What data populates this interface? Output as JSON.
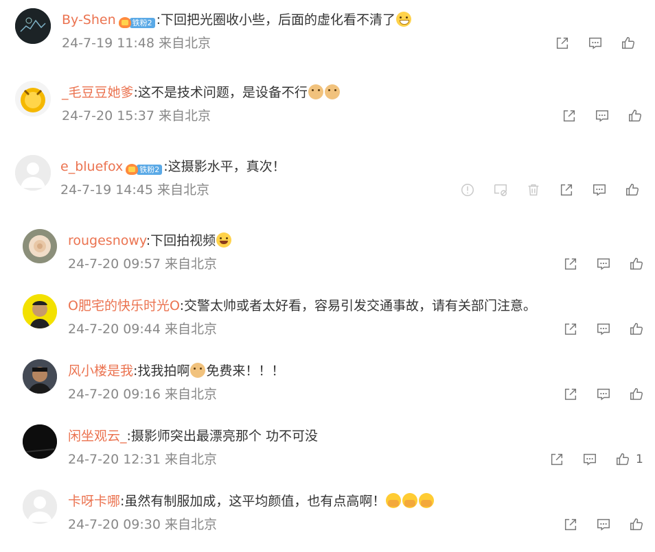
{
  "colors": {
    "username": "#eb7350",
    "meta": "#888888",
    "icon": "#777777",
    "icon_light": "#c8c8c8"
  },
  "comments": [
    {
      "username": "By-Shen",
      "fan_badge": "铁粉2",
      "text": ":下回把光圈收小些，后面的虚化看不清了",
      "emojis": [
        "grin"
      ],
      "time": "24-7-19 11:48",
      "location": "来自北京",
      "likes": ""
    },
    {
      "username": "_毛豆豆她爹",
      "fan_badge": "",
      "text": ":这不是技术问题，是设备不行",
      "emojis": [
        "doge",
        "doge"
      ],
      "time": "24-7-20 15:37",
      "location": "来自北京",
      "likes": ""
    },
    {
      "username": "e_bluefox",
      "fan_badge": "铁粉2",
      "text": ":这摄影水平，真次！",
      "emojis": [],
      "time": "24-7-19 14:45",
      "location": "来自北京",
      "likes": ""
    }
  ],
  "replies": [
    {
      "username": "rougesnowy",
      "text": ":下回拍视频",
      "emojis": [
        "laugh"
      ],
      "time": "24-7-20 09:57",
      "location": "来自北京",
      "likes": ""
    },
    {
      "username": "O肥宅的快乐时光O",
      "text": ":交警太帅或者太好看，容易引发交通事故，请有关部门注意。",
      "emojis": [],
      "time": "24-7-20 09:44",
      "location": "来自北京",
      "likes": ""
    },
    {
      "username": "风小楼是我",
      "text": ":找我拍啊",
      "text_after": "免费来！！！",
      "emojis": [
        "doge"
      ],
      "time": "24-7-20 09:16",
      "location": "来自北京",
      "likes": ""
    },
    {
      "username": "闲坐观云_",
      "text": ":摄影师突出最漂亮那个  功不可没",
      "emojis": [],
      "time": "24-7-20 12:31",
      "location": "来自北京",
      "likes": "1"
    },
    {
      "username": "卡呀卡哪",
      "text": ":虽然有制服加成，这平均颜值，也有点高啊！",
      "emojis": [
        "clap",
        "clap",
        "clap"
      ],
      "time": "24-7-20 09:30",
      "location": "来自北京",
      "likes": ""
    }
  ]
}
